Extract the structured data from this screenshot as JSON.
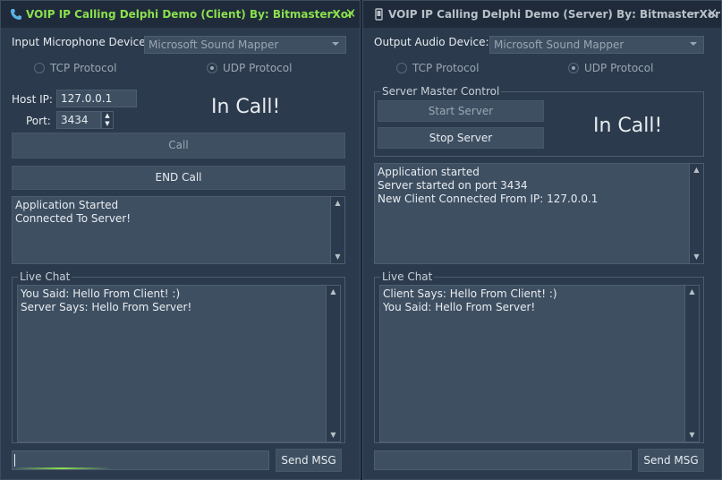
{
  "client": {
    "title": "VOIP IP Calling Delphi Demo (Client) By: BitmasterXor",
    "icon": "phone-icon",
    "mic_label": "Input Microphone Device:",
    "mic_value": "Microsoft Sound Mapper",
    "tcp_label": "TCP Protocol",
    "udp_label": "UDP Protocol",
    "selected_protocol": "UDP",
    "host_label": "Host IP:",
    "host_value": "127.0.0.1",
    "port_label": "Port:",
    "port_value": "3434",
    "status_text": "In Call!",
    "call_label": "Call",
    "end_call_label": "END Call",
    "log": [
      "Application Started",
      "Connected To Server!"
    ],
    "chat_caption": "Live Chat",
    "chat": [
      "You Said: Hello From Client! :)",
      "Server Says: Hello From Server!"
    ],
    "chat_input": "",
    "send_label": "Send MSG"
  },
  "server": {
    "title": "VOIP IP Calling Delphi Demo (Server) By: BitmasterXor",
    "icon": "mobile-phone-icon",
    "out_label": "Output Audio Device:",
    "out_value": "Microsoft Sound Mapper",
    "tcp_label": "TCP Protocol",
    "udp_label": "UDP Protocol",
    "selected_protocol": "UDP",
    "master_caption": "Server Master Control",
    "start_label": "Start Server",
    "stop_label": "Stop Server",
    "status_text": "In Call!",
    "log": [
      "Application started",
      "Server started on port 3434",
      "New Client Connected From IP: 127.0.0.1"
    ],
    "chat_caption": "Live Chat",
    "chat": [
      "Client Says: Hello From Client! :)",
      "You Said: Hello From Server!"
    ],
    "chat_input": "",
    "send_label": "Send MSG"
  },
  "colors": {
    "accent": "#8be04e",
    "window_bg": "#2b3a4c",
    "titlebar_bg": "#1f2b3a",
    "control_bg": "#3e4f62"
  }
}
